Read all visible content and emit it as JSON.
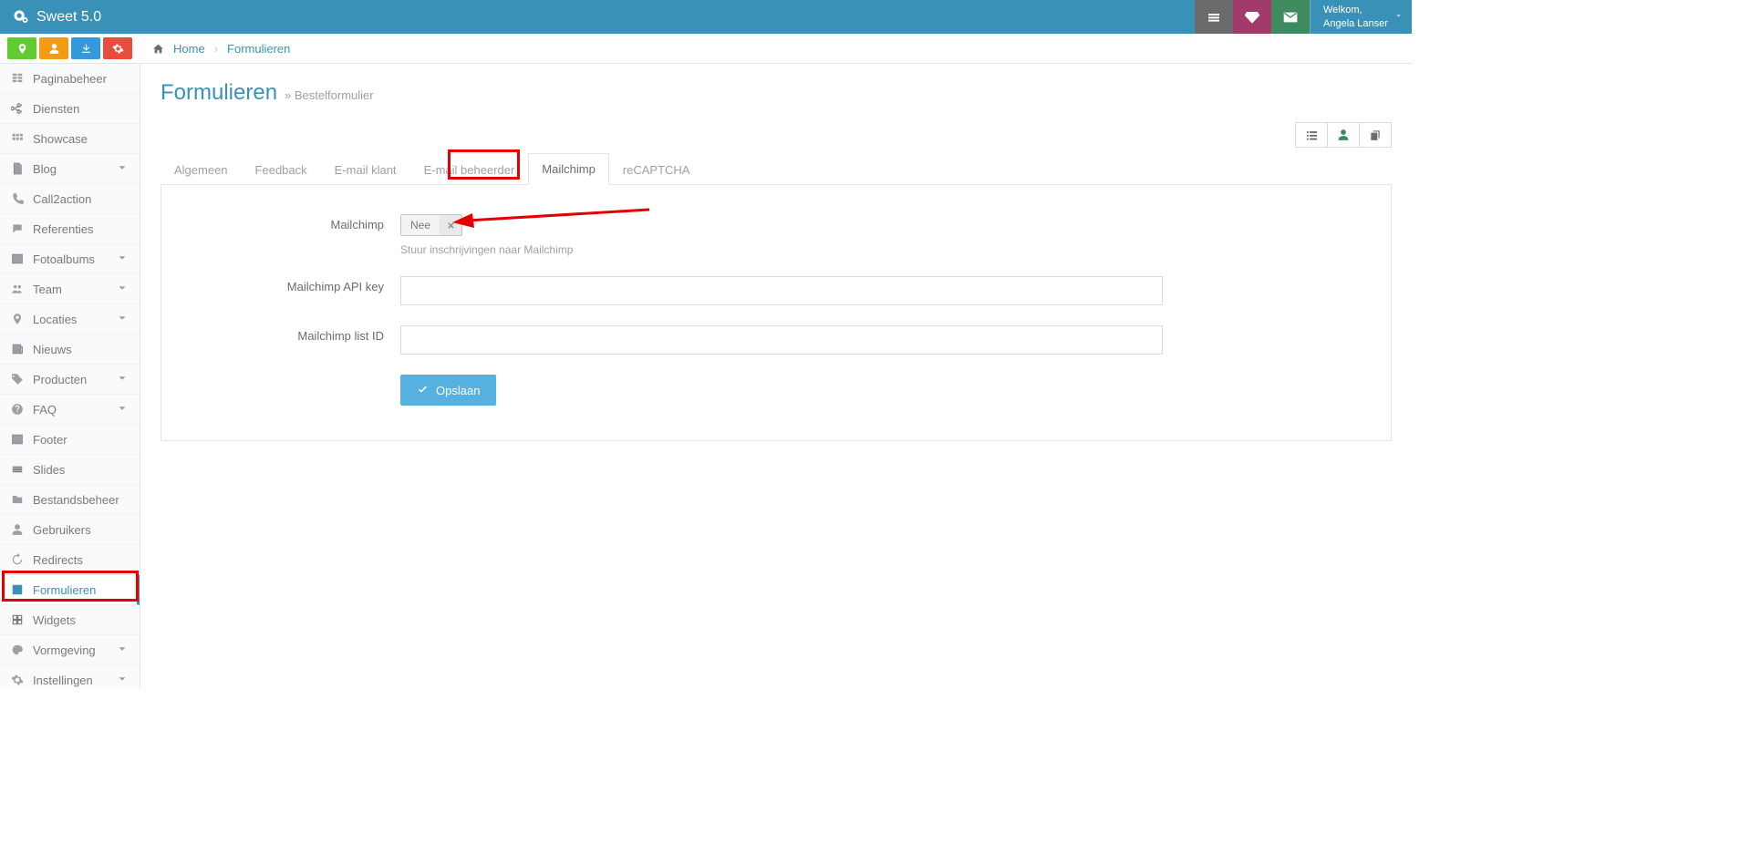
{
  "brand": "Sweet 5.0",
  "user": {
    "welcome": "Welkom,",
    "name": "Angela Lanser"
  },
  "breadcrumb": {
    "home": "Home",
    "current": "Formulieren"
  },
  "pageTitle": {
    "main": "Formulieren",
    "sub": "» Bestelformulier"
  },
  "tabs": [
    "Algemeen",
    "Feedback",
    "E-mail klant",
    "E-mail beheerder",
    "Mailchimp",
    "reCAPTCHA"
  ],
  "activeTab": "Mailchimp",
  "form": {
    "toggleLabel": "Mailchimp",
    "toggleValue": "Nee",
    "toggleHelp": "Stuur inschrijvingen naar Mailchimp",
    "apiKeyLabel": "Mailchimp API key",
    "apiKeyValue": "",
    "listIdLabel": "Mailchimp list ID",
    "listIdValue": "",
    "saveLabel": "Opslaan"
  },
  "sideQuick": [
    "map-marker-icon",
    "user-icon",
    "download-icon",
    "cogs-icon"
  ],
  "sideNav": [
    {
      "label": "Paginabeheer",
      "icon": "grid-icon",
      "chev": false,
      "active": false
    },
    {
      "label": "Diensten",
      "icon": "share-icon",
      "chev": false,
      "active": false
    },
    {
      "label": "Showcase",
      "icon": "apps-icon",
      "chev": false,
      "active": false
    },
    {
      "label": "Blog",
      "icon": "file-icon",
      "chev": true,
      "active": false
    },
    {
      "label": "Call2action",
      "icon": "phone-icon",
      "chev": false,
      "active": false
    },
    {
      "label": "Referenties",
      "icon": "chat-icon",
      "chev": false,
      "active": false
    },
    {
      "label": "Fotoalbums",
      "icon": "image-icon",
      "chev": true,
      "active": false
    },
    {
      "label": "Team",
      "icon": "people-icon",
      "chev": true,
      "active": false
    },
    {
      "label": "Locaties",
      "icon": "marker-icon",
      "chev": true,
      "active": false
    },
    {
      "label": "Nieuws",
      "icon": "news-icon",
      "chev": false,
      "active": false
    },
    {
      "label": "Producten",
      "icon": "tag-icon",
      "chev": true,
      "active": false
    },
    {
      "label": "FAQ",
      "icon": "help-icon",
      "chev": true,
      "active": false
    },
    {
      "label": "Footer",
      "icon": "footer-icon",
      "chev": false,
      "active": false
    },
    {
      "label": "Slides",
      "icon": "slides-icon",
      "chev": false,
      "active": false
    },
    {
      "label": "Bestandsbeheer",
      "icon": "folder-icon",
      "chev": false,
      "active": false
    },
    {
      "label": "Gebruikers",
      "icon": "person-icon",
      "chev": false,
      "active": false
    },
    {
      "label": "Redirects",
      "icon": "redirect-icon",
      "chev": false,
      "active": false
    },
    {
      "label": "Formulieren",
      "icon": "form-icon",
      "chev": false,
      "active": true
    },
    {
      "label": "Widgets",
      "icon": "widget-icon",
      "chev": false,
      "active": false
    },
    {
      "label": "Vormgeving",
      "icon": "palette-icon",
      "chev": true,
      "active": false
    },
    {
      "label": "Instellingen",
      "icon": "cog-icon",
      "chev": true,
      "active": false
    }
  ]
}
